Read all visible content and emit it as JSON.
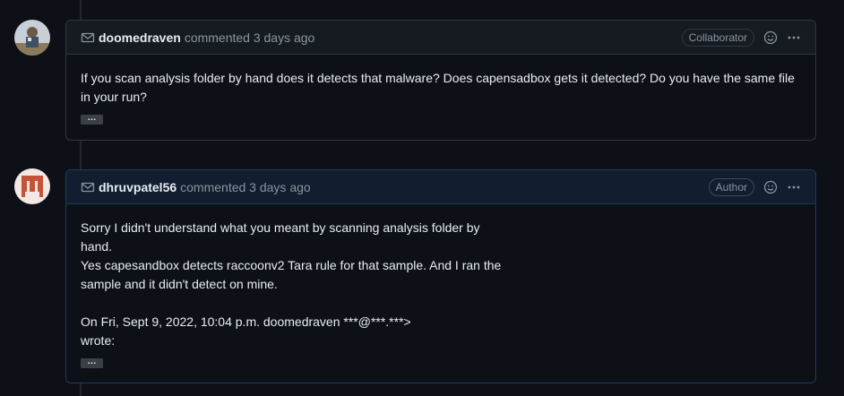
{
  "comments": [
    {
      "username": "doomedraven",
      "action": "commented 3 days ago",
      "role": "Collaborator",
      "body": [
        "If you scan analysis folder by hand does it detects that malware? Does capensadbox gets it detected? Do you have the same file in your run?"
      ],
      "expander": "…"
    },
    {
      "username": "dhruvpatel56",
      "action": "commented 3 days ago",
      "role": "Author",
      "body": [
        "Sorry I didn't understand what you meant by scanning analysis folder by",
        "hand.",
        "Yes capesandbox detects raccoonv2 Tara rule for that sample. And I ran the",
        "sample and it didn't detect on mine.",
        "",
        "On Fri, Sept 9, 2022, 10:04 p.m. doomedraven ***@***.***>",
        "wrote:"
      ],
      "expander": "…"
    }
  ],
  "icons": {
    "mail": "mail-icon",
    "smiley": "smiley-icon",
    "kebab": "kebab-icon"
  },
  "colors": {
    "background": "#0d1117",
    "header": "#161b22",
    "author_header": "#121d2f",
    "border": "#30363d",
    "muted_text": "#8b949e"
  }
}
